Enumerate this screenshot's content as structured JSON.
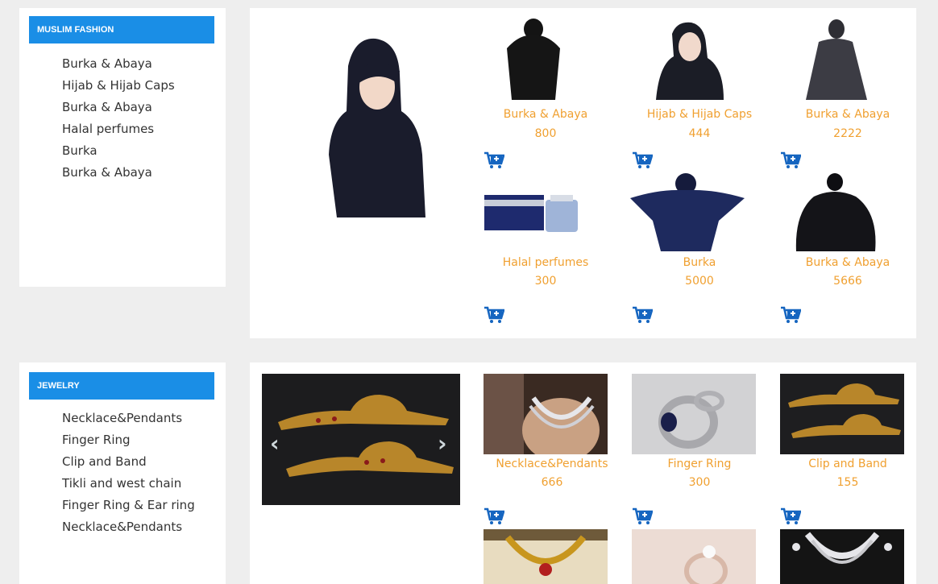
{
  "muslim_fashion": {
    "heading": "MUSLIM FASHION",
    "categories": [
      "Burka & Abaya",
      "Hijab & Hijab Caps",
      "Burka & Abaya",
      "Halal perfumes",
      "Burka",
      "Burka & Abaya"
    ],
    "products": [
      {
        "name": "Burka & Abaya",
        "price": "800",
        "image": "black-burka-photo"
      },
      {
        "name": "Hijab & Hijab Caps",
        "price": "444",
        "image": "hijab-photo"
      },
      {
        "name": "Burka & Abaya",
        "price": "2222",
        "image": "grey-abaya-photo"
      },
      {
        "name": "Halal perfumes",
        "price": "300",
        "image": "perfume-photo"
      },
      {
        "name": "Burka",
        "price": "5000",
        "image": "navy-burka-photo"
      },
      {
        "name": "Burka & Abaya",
        "price": "5666",
        "image": "black-abaya-photo"
      }
    ]
  },
  "jewelry": {
    "heading": "JEWELRY",
    "categories": [
      "Necklace&Pendants",
      "Finger Ring",
      "Clip and Band",
      "Tikli and west chain",
      "Finger Ring & Ear ring",
      "Necklace&Pendants"
    ],
    "products": [
      {
        "name": "Necklace&Pendants",
        "price": "666",
        "image": "silver-necklace-photo"
      },
      {
        "name": "Finger Ring",
        "price": "300",
        "image": "sapphire-ring-photo"
      },
      {
        "name": "Clip and Band",
        "price": "155",
        "image": "gold-clip-photo"
      },
      {
        "name": "",
        "price": "",
        "image": "gold-necklace-photo"
      },
      {
        "name": "",
        "price": "",
        "image": "diamond-ring-photo"
      },
      {
        "name": "",
        "price": "",
        "image": "diamond-necklace-photo"
      }
    ]
  },
  "icons": {
    "cart": "add-to-cart-icon",
    "prev": "chevron-left-icon",
    "next": "chevron-right-icon"
  },
  "colors": {
    "header_blue": "#1a8ee6",
    "price_orange": "#f0a030",
    "cart_blue": "#1565c0",
    "background": "#eeeeee"
  }
}
